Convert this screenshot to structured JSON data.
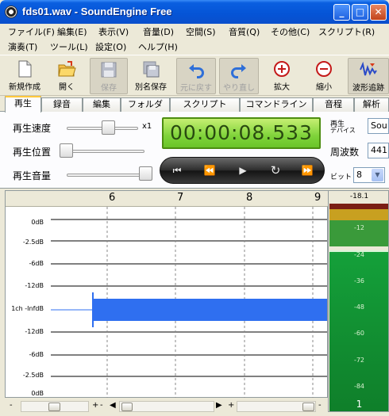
{
  "window": {
    "title": "fds01.wav - SoundEngine Free",
    "minimize": "_",
    "maximize": "□",
    "close": "✕"
  },
  "menus": {
    "row1": [
      "ファイル(F)",
      "編集(E)",
      "表示(V)",
      "音量(D)",
      "空間(S)",
      "音質(Q)",
      "その他(C)",
      "スクリプト(R)"
    ],
    "row2": [
      "演奏(T)",
      "ツール(L)",
      "設定(O)",
      "ヘルプ(H)"
    ]
  },
  "toolbar": {
    "new": "新規作成",
    "open": "開く",
    "save": "保存",
    "save_as": "別名保存",
    "undo": "元に戻す",
    "redo": "やり直し",
    "zoom_in": "拡大",
    "zoom_out": "縮小",
    "wave_follow": "波形追跡"
  },
  "tabs": [
    "再生",
    "録音",
    "編集",
    "フォルダ",
    "スクリプト",
    "コマンドライン",
    "音程",
    "解析"
  ],
  "playback": {
    "speed_label": "再生速度",
    "position_label": "再生位置",
    "volume_label": "再生音量",
    "speed_value": "x1",
    "speed_level": 0.6,
    "position_level": 0.0,
    "volume_level": 1.0,
    "time": "00:00:08.533",
    "device_label_1": "再生",
    "device_label_2": "デバイス",
    "device_value": "Sou",
    "freq_label": "周波数",
    "freq_value": "441",
    "bit_label": "ビット",
    "bit_value": "8"
  },
  "transport": {
    "skip_start": "⏮",
    "rewind": "⏪",
    "play": "▶",
    "loop": "↻",
    "forward": "⏩"
  },
  "waveform": {
    "ruler": [
      "6",
      "7",
      "8",
      "9"
    ],
    "db_labels": [
      "0dB",
      "-2.5dB",
      "-6dB",
      "-12dB",
      "1ch -InfdB",
      "-12dB",
      "-6dB",
      "-2.5dB",
      "0dB"
    ]
  },
  "meter": {
    "peak": "-18.1",
    "scale": [
      "-12",
      "-24",
      "-36",
      "-48",
      "-60",
      "-72",
      "-84"
    ],
    "channel": "1"
  },
  "scrollbar": {
    "minus": "-",
    "plus": "+",
    "left": "◀",
    "right": "▶"
  },
  "colors": {
    "waveform": "#2f6ff0",
    "lcd_green": "#7fd33a",
    "meter_green": "#128a2e"
  }
}
